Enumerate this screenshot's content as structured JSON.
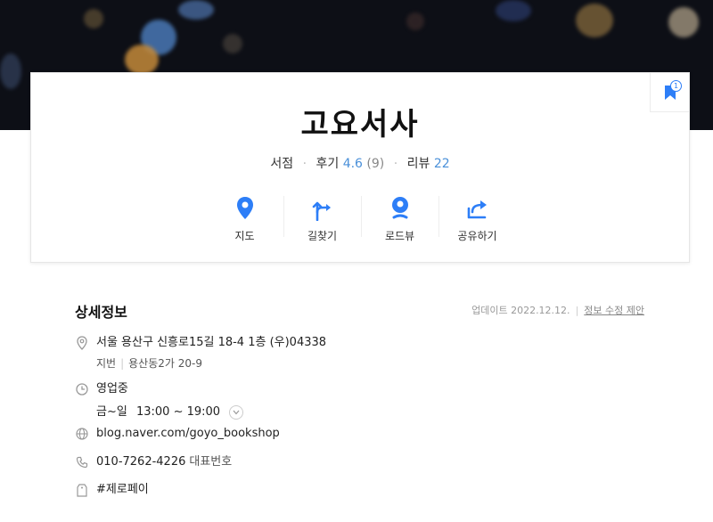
{
  "place": {
    "name": "고요서사",
    "category": "서점",
    "review_label": "후기",
    "rating": "4.6",
    "rating_count": "(9)",
    "blog_review_label": "리뷰",
    "blog_review_count": "22",
    "bookmark_count": "1"
  },
  "actions": [
    {
      "label": "지도",
      "icon": "map-pin-icon"
    },
    {
      "label": "길찾기",
      "icon": "directions-icon"
    },
    {
      "label": "로드뷰",
      "icon": "roadview-icon"
    },
    {
      "label": "공유하기",
      "icon": "share-icon"
    }
  ],
  "details": {
    "title": "상세정보",
    "updated": "업데이트 2022.12.12.",
    "suggest_edit": "정보 수정 제안",
    "address": "서울 용산구 신흥로15길 18-4 1층 (우)04338",
    "jibun_label": "지번",
    "jibun": "용산동2가 20-9",
    "status": "영업중",
    "hours_days": "금~일",
    "hours_time": "13:00 ~ 19:00",
    "website": "blog.naver.com/goyo_bookshop",
    "phone": "010-7262-4226",
    "phone_label": "대표번호",
    "tag": "#제로페이"
  },
  "colors": {
    "accent_blue": "#2d7ef7",
    "open_green": "#2db400",
    "link_blue": "#4a6fa5"
  }
}
